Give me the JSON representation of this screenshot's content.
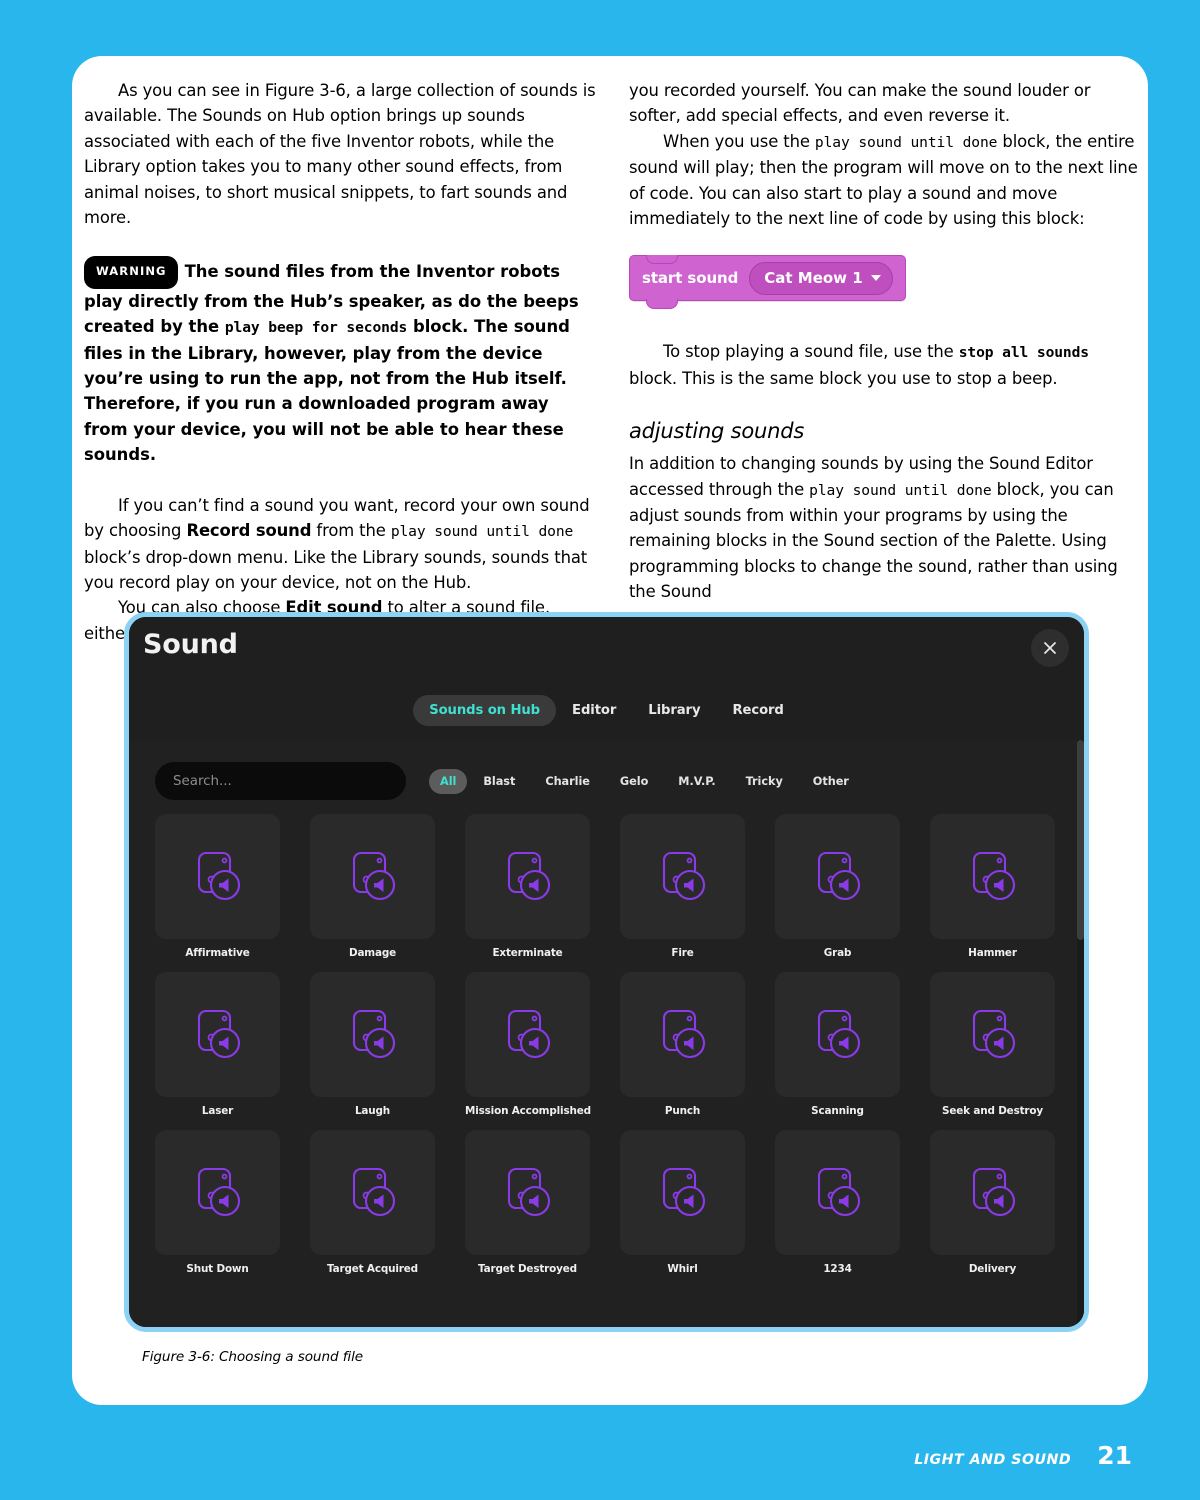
{
  "page": {
    "background_color": "#29b6ed",
    "sheet_color": "#ffffff",
    "running_head": "LIGHT AND SOUND",
    "page_number": "21"
  },
  "left_column": {
    "para1_a": "As you can see in Figure 3-6, a large collection of sounds is available. The Sounds on Hub option brings up sounds associated with each of the five Inventor robots, while the Library option takes you to many other sound effects, from animal noises, to short musical snippets, to fart sounds and more.",
    "warning": {
      "badge": "WARNING",
      "t1": "The sound files from the Inventor robots play directly from the Hub’s speaker, as do the beeps created by the ",
      "code1": "play beep for  seconds",
      "t2": " block. The sound files in the Library, however, play from the device you’re using to run the app, not from the Hub itself. Therefore, if you run a downloaded program away from your device, you will not be able to hear these sounds."
    },
    "para2": {
      "t1": "If you can’t find a sound you want, record your own sound by choosing ",
      "b1": "Record sound",
      "t2": " from the ",
      "code1": "play sound until done",
      "t3": " block’s drop-down menu. Like the Library sounds, sounds that you record play on your device, not on the Hub."
    },
    "para3": {
      "t1": "You can also choose ",
      "b1": "Edit sound",
      "t2": " to alter a sound file, either one of the sound files that comes with the app or one"
    }
  },
  "right_column": {
    "para1": "you recorded yourself. You can make the sound louder or softer, add special effects, and even reverse it.",
    "para2": {
      "t1": "When you use the ",
      "code1": "play sound until done",
      "t2": " block, the entire sound will play; then the program will move on to the next line of code. You can also start to play a sound and move immediately to the next line of code by using this block:"
    },
    "scratch_block": {
      "label": "start sound",
      "dropdown_value": "Cat Meow 1",
      "block_color": "#cf63cf",
      "dropdown_color": "#bf4fbf",
      "dropdown_icon": "chevron-down-icon"
    },
    "para3": {
      "t1": "To stop playing a sound file, use the ",
      "code1": "stop all sounds",
      "t2": " block. This is the same block you use to stop a beep."
    },
    "heading": "adjusting sounds",
    "para4": {
      "t1": "In addition to changing sounds by using the Sound Editor accessed through the ",
      "code1": "play sound until done",
      "t2": " block, you can adjust sounds from within your programs by using the remaining blocks in the Sound section of the Palette. Using programming blocks to change the sound, rather than using the Sound"
    }
  },
  "figure": {
    "caption": "Figure 3-6: Choosing a sound file",
    "border_color": "#8cd2f4",
    "app": {
      "title": "Sound",
      "close_icon": "close-icon",
      "tabs": [
        {
          "label": "Sounds on Hub",
          "active": true
        },
        {
          "label": "Editor",
          "active": false
        },
        {
          "label": "Library",
          "active": false
        },
        {
          "label": "Record",
          "active": false
        }
      ],
      "accent_color": "#3fe0cf",
      "search": {
        "placeholder": "Search...",
        "value": ""
      },
      "filters": [
        {
          "label": "All",
          "active": true
        },
        {
          "label": "Blast",
          "active": false
        },
        {
          "label": "Charlie",
          "active": false
        },
        {
          "label": "Gelo",
          "active": false
        },
        {
          "label": "M.V.P.",
          "active": false
        },
        {
          "label": "Tricky",
          "active": false
        },
        {
          "label": "Other",
          "active": false
        }
      ],
      "tile_icon": "sound-file-icon",
      "tiles": [
        {
          "label": "Affirmative"
        },
        {
          "label": "Damage"
        },
        {
          "label": "Exterminate"
        },
        {
          "label": "Fire"
        },
        {
          "label": "Grab"
        },
        {
          "label": "Hammer"
        },
        {
          "label": "Laser"
        },
        {
          "label": "Laugh"
        },
        {
          "label": "Mission Accomplished"
        },
        {
          "label": "Punch"
        },
        {
          "label": "Scanning"
        },
        {
          "label": "Seek and Destroy"
        },
        {
          "label": "Shut Down"
        },
        {
          "label": "Target Acquired"
        },
        {
          "label": "Target Destroyed"
        },
        {
          "label": "Whirl"
        },
        {
          "label": "1234"
        },
        {
          "label": "Delivery"
        }
      ],
      "icon_color": "#8b3ae8"
    }
  }
}
